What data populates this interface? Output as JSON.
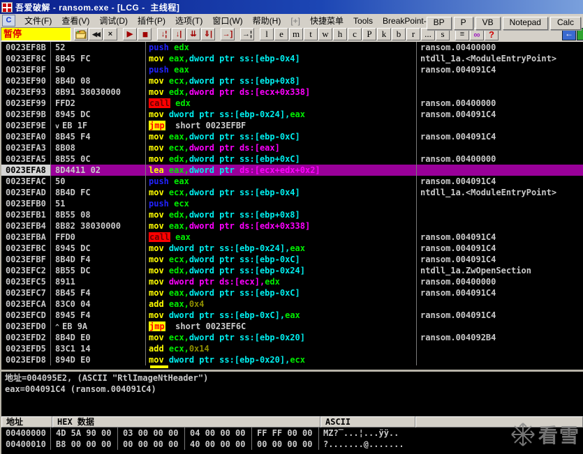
{
  "window": {
    "title": "吾爱破解 - ransom.exe - [LCG -  主线程]"
  },
  "menu": {
    "system_icon": "C",
    "items": [
      {
        "label": "文件(F)",
        "name": "menu-file"
      },
      {
        "label": "查看(V)",
        "name": "menu-view"
      },
      {
        "label": "调试(D)",
        "name": "menu-debug"
      },
      {
        "label": "插件(P)",
        "name": "menu-plugins"
      },
      {
        "label": "选项(T)",
        "name": "menu-options"
      },
      {
        "label": "窗口(W)",
        "name": "menu-window"
      },
      {
        "label": "帮助(H)",
        "name": "menu-help"
      },
      {
        "label": "[+]",
        "name": "menu-plus",
        "dim": true
      },
      {
        "label": "快捷菜单",
        "name": "menu-quick"
      },
      {
        "label": "Tools",
        "name": "menu-tools"
      },
      {
        "label": "BreakPoint->",
        "name": "menu-breakpoint"
      }
    ],
    "right_buttons": [
      {
        "label": "BP",
        "name": "plugin-bp-button"
      },
      {
        "label": "P",
        "name": "plugin-p-button"
      },
      {
        "label": "VB",
        "name": "plugin-vb-button"
      },
      {
        "label": "Notepad",
        "name": "plugin-notepad-button"
      },
      {
        "label": "Calc",
        "name": "plugin-calc-button"
      }
    ]
  },
  "toolbar": {
    "status": "暂停",
    "buttons": [
      {
        "name": "open-file-button",
        "icon": "folder-icon",
        "type": "folder"
      },
      {
        "name": "restart-button",
        "icon": "rewind-icon",
        "glyph": "◀◀",
        "style": "blk small"
      },
      {
        "name": "close-button",
        "icon": "close-icon",
        "glyph": "×",
        "style": "blk"
      },
      {
        "name": "run-button",
        "icon": "play-icon",
        "glyph": "▶",
        "style": "red",
        "gap": true
      },
      {
        "name": "pause-button",
        "icon": "pause-icon",
        "glyph": "▮▮",
        "style": "red small"
      },
      {
        "name": "step-into-button",
        "icon": "step-into-icon",
        "glyph": "↓¦",
        "style": "red",
        "gap": true
      },
      {
        "name": "step-over-button",
        "icon": "step-over-icon",
        "glyph": "↓|",
        "style": "red"
      },
      {
        "name": "animate-into-button",
        "icon": "animate-into-icon",
        "glyph": "⇊",
        "style": "red"
      },
      {
        "name": "animate-over-button",
        "icon": "animate-over-icon",
        "glyph": "⇓|",
        "style": "red"
      },
      {
        "name": "execute-till-return-button",
        "icon": "return-icon",
        "glyph": "→]",
        "style": "red",
        "gap": true
      },
      {
        "name": "execute-till-user-button",
        "icon": "till-user-icon",
        "glyph": "→¦",
        "style": "blk",
        "gap": true
      }
    ],
    "letters": [
      {
        "label": "l",
        "name": "log-window-button",
        "gap": true
      },
      {
        "label": "e",
        "name": "executables-window-button"
      },
      {
        "label": "m",
        "name": "memory-window-button"
      },
      {
        "label": "t",
        "name": "threads-window-button"
      },
      {
        "label": "w",
        "name": "windows-window-button"
      },
      {
        "label": "h",
        "name": "handles-window-button"
      },
      {
        "label": "c",
        "name": "cpu-window-button"
      },
      {
        "label": "P",
        "name": "patches-window-button"
      },
      {
        "label": "k",
        "name": "callstack-window-button"
      },
      {
        "label": "b",
        "name": "breakpoints-window-button"
      },
      {
        "label": "r",
        "name": "references-window-button"
      },
      {
        "label": "...",
        "name": "more-windows-button"
      },
      {
        "label": "s",
        "name": "source-window-button"
      }
    ],
    "view_buttons": [
      {
        "name": "appearance-button",
        "icon": "list-icon",
        "glyph": "≡",
        "style": "blk",
        "gap": true
      },
      {
        "name": "search-button",
        "icon": "binoculars-icon",
        "glyph": "∞",
        "style": "purple"
      },
      {
        "name": "help-button",
        "icon": "question-icon",
        "glyph": "?",
        "style": "redq"
      }
    ]
  },
  "disasm": {
    "rows": [
      {
        "a": "0023EF8B",
        "b": "52",
        "t": [
          [
            "push",
            "p"
          ],
          [
            " edx",
            "r"
          ]
        ],
        "c": "ransom.00400000"
      },
      {
        "a": "0023EF8C",
        "b": "8B45 FC",
        "t": [
          [
            "mov",
            "m"
          ],
          [
            " eax,",
            "r"
          ],
          [
            "dword ptr ss:[ebp-0x4]",
            "s"
          ]
        ],
        "c": "ntdll_1a.<ModuleEntryPoint>"
      },
      {
        "a": "0023EF8F",
        "b": "50",
        "t": [
          [
            "push",
            "p"
          ],
          [
            " eax",
            "r"
          ]
        ],
        "c": "ransom.004091C4"
      },
      {
        "a": "0023EF90",
        "b": "8B4D 08",
        "t": [
          [
            "mov",
            "m"
          ],
          [
            " ecx,",
            "r"
          ],
          [
            "dword ptr ss:[ebp+0x8]",
            "s"
          ]
        ],
        "c": ""
      },
      {
        "a": "0023EF93",
        "b": "8B91 38030000",
        "t": [
          [
            "mov",
            "m"
          ],
          [
            " edx,",
            "r"
          ],
          [
            "dword ptr ds:[ecx+0x338]",
            "d"
          ]
        ],
        "c": ""
      },
      {
        "a": "0023EF99",
        "b": "FFD2",
        "t": [
          [
            "call",
            "c"
          ],
          [
            " edx",
            "r"
          ]
        ],
        "c": "ransom.00400000"
      },
      {
        "a": "0023EF9B",
        "b": "8945 DC",
        "t": [
          [
            "mov",
            "m"
          ],
          [
            " ",
            "t"
          ],
          [
            "dword ptr ss:[ebp-0x24],",
            "s"
          ],
          [
            "eax",
            "r"
          ]
        ],
        "c": "ransom.004091C4"
      },
      {
        "a": "0023EF9E",
        "ar": "v",
        "b": "EB 1F",
        "t": [
          [
            "jmp",
            "j"
          ],
          [
            "  short 0023EFBF",
            "t"
          ]
        ],
        "c": ""
      },
      {
        "a": "0023EFA0",
        "b": "8B45 F4",
        "t": [
          [
            "mov",
            "m"
          ],
          [
            " eax,",
            "r"
          ],
          [
            "dword ptr ss:[ebp-0xC]",
            "s"
          ]
        ],
        "c": "ransom.004091C4"
      },
      {
        "a": "0023EFA3",
        "b": "8B08",
        "t": [
          [
            "mov",
            "m"
          ],
          [
            " ecx,",
            "r"
          ],
          [
            "dword ptr ds:[eax]",
            "d"
          ]
        ],
        "c": ""
      },
      {
        "a": "0023EFA5",
        "b": "8B55 0C",
        "t": [
          [
            "mov",
            "m"
          ],
          [
            " edx,",
            "r"
          ],
          [
            "dword ptr ss:[ebp+0xC]",
            "s"
          ]
        ],
        "c": "ransom.00400000"
      },
      {
        "a": "0023EFA8",
        "b": "8D4411 02",
        "sel": true,
        "t": [
          [
            "lea",
            "m"
          ],
          [
            " eax,",
            "r"
          ],
          [
            "dword ptr ",
            "s"
          ],
          [
            "ds:[ecx+edx+0x2]",
            "d"
          ]
        ],
        "c": ""
      },
      {
        "a": "0023EFAC",
        "b": "50",
        "t": [
          [
            "push",
            "p"
          ],
          [
            " eax",
            "r"
          ]
        ],
        "c": "ransom.004091C4"
      },
      {
        "a": "0023EFAD",
        "b": "8B4D FC",
        "t": [
          [
            "mov",
            "m"
          ],
          [
            " ecx,",
            "r"
          ],
          [
            "dword ptr ss:[ebp-0x4]",
            "s"
          ]
        ],
        "c": "ntdll_1a.<ModuleEntryPoint>"
      },
      {
        "a": "0023EFB0",
        "b": "51",
        "t": [
          [
            "push",
            "p"
          ],
          [
            " ecx",
            "r"
          ]
        ],
        "c": ""
      },
      {
        "a": "0023EFB1",
        "b": "8B55 08",
        "t": [
          [
            "mov",
            "m"
          ],
          [
            " edx,",
            "r"
          ],
          [
            "dword ptr ss:[ebp+0x8]",
            "s"
          ]
        ],
        "c": ""
      },
      {
        "a": "0023EFB4",
        "b": "8B82 38030000",
        "t": [
          [
            "mov",
            "m"
          ],
          [
            " eax,",
            "r"
          ],
          [
            "dword ptr ds:[edx+0x338]",
            "d"
          ]
        ],
        "c": ""
      },
      {
        "a": "0023EFBA",
        "b": "FFD0",
        "t": [
          [
            "call",
            "c"
          ],
          [
            " eax",
            "r"
          ]
        ],
        "c": "ransom.004091C4"
      },
      {
        "a": "0023EFBC",
        "b": "8945 DC",
        "t": [
          [
            "mov",
            "m"
          ],
          [
            " ",
            "t"
          ],
          [
            "dword ptr ss:[ebp-0x24],",
            "s"
          ],
          [
            "eax",
            "r"
          ]
        ],
        "c": "ransom.004091C4"
      },
      {
        "a": "0023EFBF",
        "b": "8B4D F4",
        "t": [
          [
            "mov",
            "m"
          ],
          [
            " ecx,",
            "r"
          ],
          [
            "dword ptr ss:[ebp-0xC]",
            "s"
          ]
        ],
        "c": "ransom.004091C4"
      },
      {
        "a": "0023EFC2",
        "b": "8B55 DC",
        "t": [
          [
            "mov",
            "m"
          ],
          [
            " edx,",
            "r"
          ],
          [
            "dword ptr ss:[ebp-0x24]",
            "s"
          ]
        ],
        "c": "ntdll_1a.ZwOpenSection"
      },
      {
        "a": "0023EFC5",
        "b": "8911",
        "t": [
          [
            "mov",
            "m"
          ],
          [
            " ",
            "t"
          ],
          [
            "dword ptr ds:[ecx],",
            "d"
          ],
          [
            "edx",
            "r"
          ]
        ],
        "c": "ransom.00400000"
      },
      {
        "a": "0023EFC7",
        "b": "8B45 F4",
        "t": [
          [
            "mov",
            "m"
          ],
          [
            " eax,",
            "r"
          ],
          [
            "dword ptr ss:[ebp-0xC]",
            "s"
          ]
        ],
        "c": "ransom.004091C4"
      },
      {
        "a": "0023EFCA",
        "b": "83C0 04",
        "t": [
          [
            "add",
            "m"
          ],
          [
            " eax,",
            "r"
          ],
          [
            "0x4",
            "i"
          ]
        ],
        "c": ""
      },
      {
        "a": "0023EFCD",
        "b": "8945 F4",
        "t": [
          [
            "mov",
            "m"
          ],
          [
            " ",
            "t"
          ],
          [
            "dword ptr ss:[ebp-0xC],",
            "s"
          ],
          [
            "eax",
            "r"
          ]
        ],
        "c": "ransom.004091C4"
      },
      {
        "a": "0023EFD0",
        "ar": "^",
        "b": "EB 9A",
        "t": [
          [
            "jmp",
            "j"
          ],
          [
            "  short 0023EF6C",
            "t"
          ]
        ],
        "c": ""
      },
      {
        "a": "0023EFD2",
        "b": "8B4D E0",
        "t": [
          [
            "mov",
            "m"
          ],
          [
            " ecx,",
            "r"
          ],
          [
            "dword ptr ss:[ebp-0x20]",
            "s"
          ]
        ],
        "c": "ransom.004092B4"
      },
      {
        "a": "0023EFD5",
        "b": "83C1 14",
        "t": [
          [
            "add",
            "m"
          ],
          [
            " ecx,",
            "r"
          ],
          [
            "0x14",
            "i"
          ]
        ],
        "c": ""
      },
      {
        "a": "0023EFD8",
        "b": "894D E0",
        "t": [
          [
            "mov",
            "m"
          ],
          [
            " ",
            "t"
          ],
          [
            "dword ptr ss:[ebp-0x20],",
            "s"
          ],
          [
            "ecx",
            "r"
          ]
        ],
        "c": ""
      }
    ]
  },
  "info_pane": {
    "lines": [
      "地址=004095E2, (ASCII \"RtlImageNtHeader\")",
      "eax=004091C4 (ransom.004091C4)"
    ]
  },
  "dump": {
    "headers": {
      "addr": "地址",
      "hex": "HEX 数据",
      "ascii": "ASCII"
    },
    "rows": [
      {
        "addr": "00400000",
        "hex": [
          "4D 5A 90 00",
          "03 00 00 00",
          "04 00 00 00",
          "FF FF 00 00"
        ],
        "ascii": "MZ?‾...¦...ÿÿ.."
      },
      {
        "addr": "00400010",
        "hex": [
          "B8 00 00 00",
          "00 00 00 00",
          "40 00 00 00",
          "00 00 00 00"
        ],
        "ascii": "?.......@......."
      }
    ]
  },
  "watermark": {
    "text": "看雪"
  },
  "colors": {
    "selection_bg": "#990099",
    "mnemonic": "#ffff00",
    "register": "#00ee00",
    "stack_operand": "#00eeee",
    "memory_operand": "#ff00ff",
    "immediate": "#8f8f00",
    "push_keyword": "#2222ff",
    "call_bg": "#ff0000",
    "jmp_bg": "#ffff00",
    "jmp_text": "#ff0000",
    "pane_text": "#cacaca",
    "pane_bg": "#000000",
    "status_bg": "#ffff00",
    "status_text": "#e00000",
    "chrome_bg": "#d4d0c8",
    "titlebar_start": "#0b1f8c"
  }
}
